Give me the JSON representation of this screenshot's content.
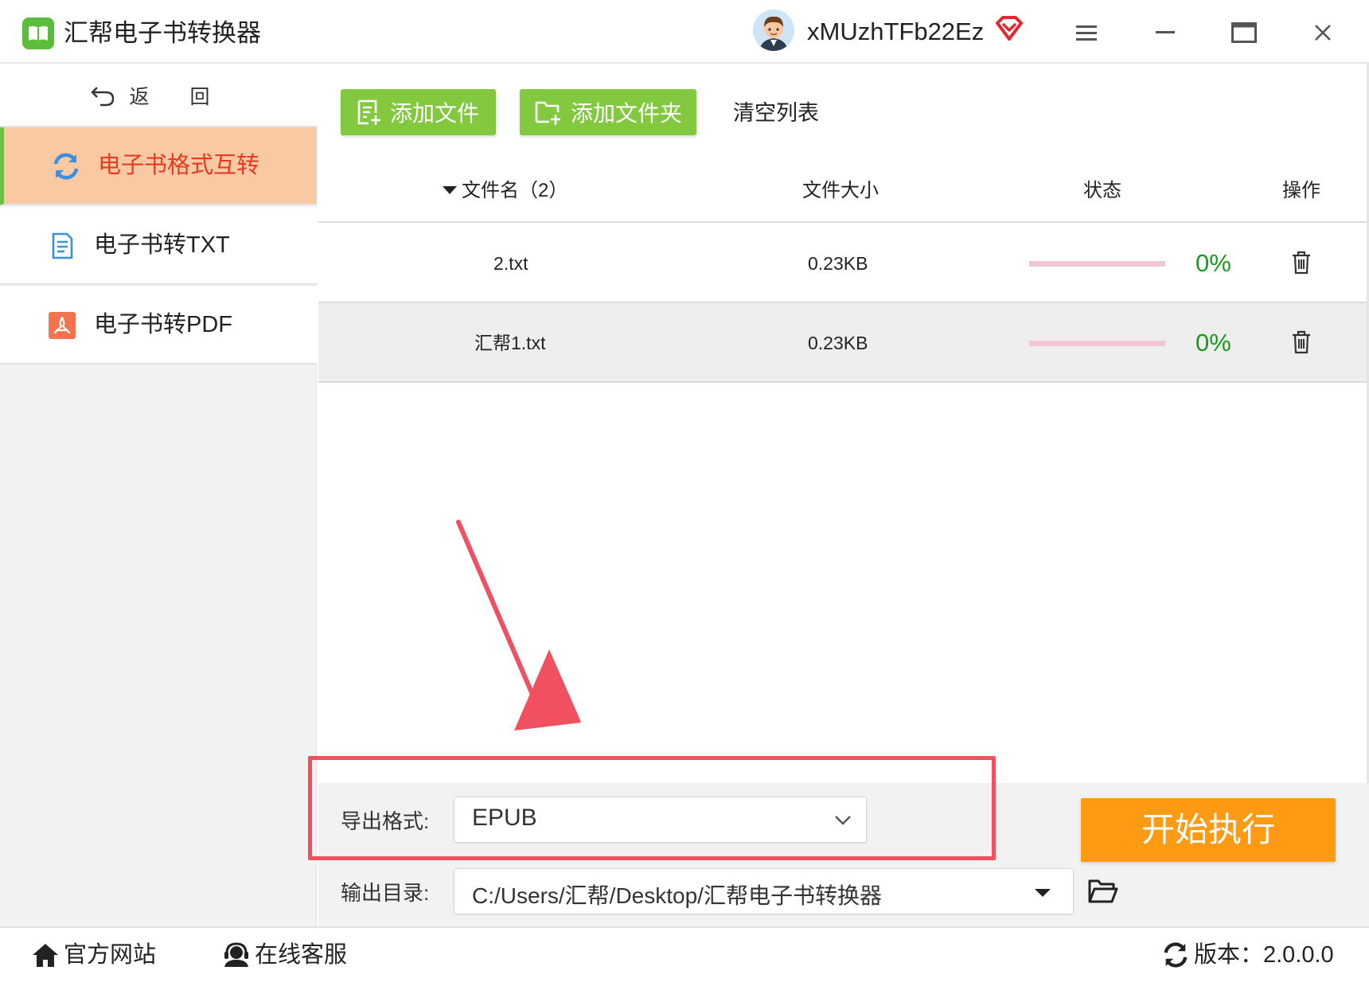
{
  "app": {
    "title": "汇帮电子书转换器",
    "username": "xMUzhTFb22Ez"
  },
  "colors": {
    "brand_green": "#82c93f",
    "active_nav_bg": "#f8c9a3",
    "active_nav_text": "#e63b1e",
    "start_orange": "#ff9a14",
    "highlight_red": "#f05060",
    "percent_green": "#1a9a1a",
    "progress_track": "#f2c6d2"
  },
  "sidebar": {
    "back_label": "返 回",
    "items": [
      {
        "label": "电子书格式互转",
        "icon": "refresh-icon",
        "active": true
      },
      {
        "label": "电子书转TXT",
        "icon": "document-icon",
        "active": false
      },
      {
        "label": "电子书转PDF",
        "icon": "pdf-icon",
        "active": false
      }
    ]
  },
  "toolbar": {
    "add_file": "添加文件",
    "add_folder": "添加文件夹",
    "clear_list": "清空列表"
  },
  "table": {
    "headers": {
      "filename": "文件名（2）",
      "size": "文件大小",
      "status": "状态",
      "action": "操作"
    },
    "rows": [
      {
        "name": "2.txt",
        "size": "0.23KB",
        "percent_label": "0%",
        "progress": 0
      },
      {
        "name": "汇帮1.txt",
        "size": "0.23KB",
        "percent_label": "0%",
        "progress": 0
      }
    ]
  },
  "settings": {
    "format_label": "导出格式:",
    "format_value": "EPUB",
    "dir_label": "输出目录:",
    "dir_value": "C:/Users/汇帮/Desktop/汇帮电子书转换器",
    "start_button": "开始执行"
  },
  "statusbar": {
    "website": "官方网站",
    "support": "在线客服",
    "version": "版本：2.0.0.0"
  }
}
